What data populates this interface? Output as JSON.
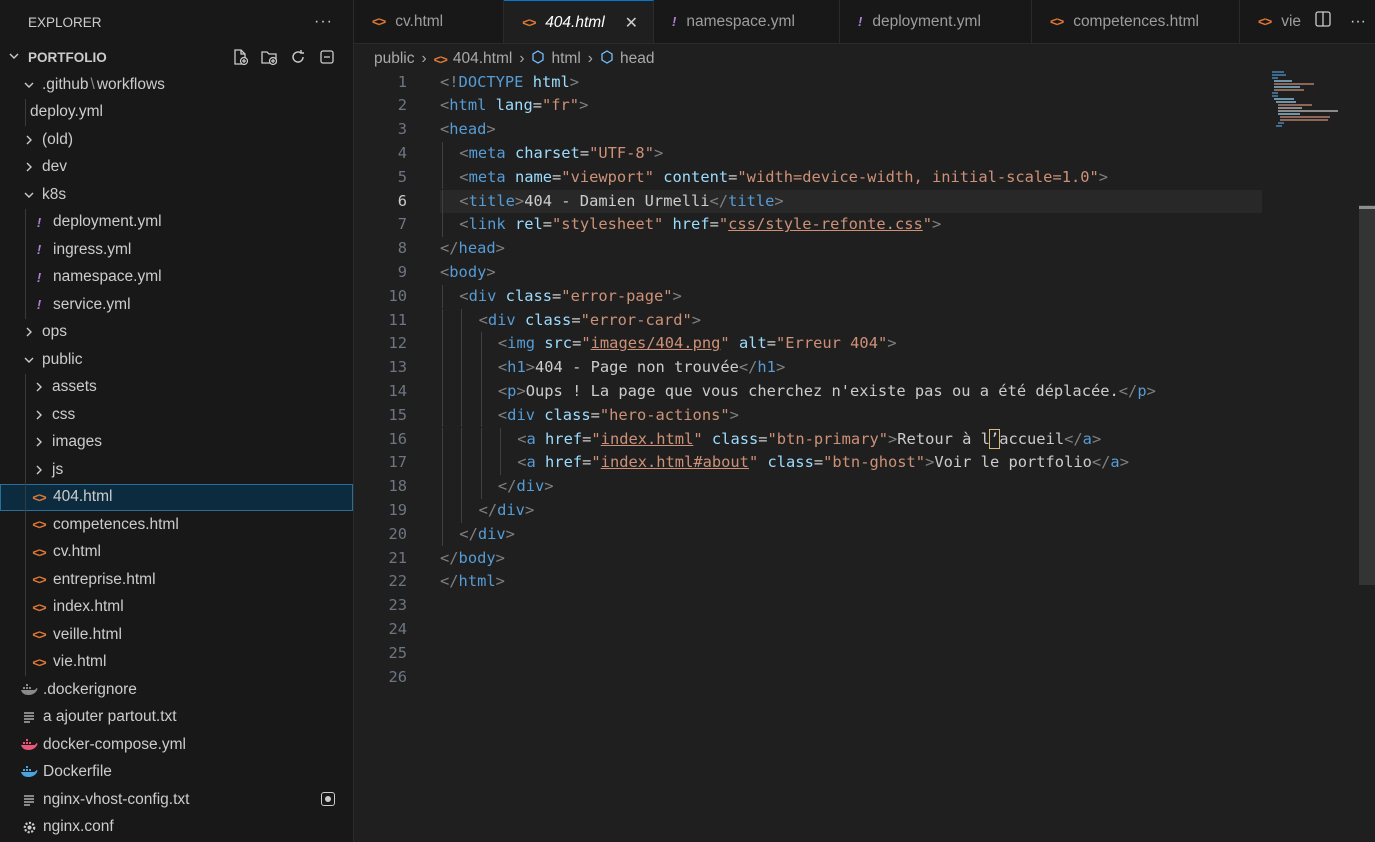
{
  "sidebar": {
    "title": "EXPLORER",
    "more": "···",
    "project": "PORTFOLIO",
    "items": [
      {
        "label": ".github",
        "label2": "workflows",
        "depth": 1,
        "kind": "folder-open"
      },
      {
        "label": "deploy.yml",
        "depth": 2,
        "kind": "file"
      },
      {
        "label": "(old)",
        "depth": 1,
        "kind": "folder"
      },
      {
        "label": "dev",
        "depth": 1,
        "kind": "folder"
      },
      {
        "label": "k8s",
        "depth": 1,
        "kind": "folder-open"
      },
      {
        "label": "deployment.yml",
        "depth": 2,
        "kind": "yml"
      },
      {
        "label": "ingress.yml",
        "depth": 2,
        "kind": "yml"
      },
      {
        "label": "namespace.yml",
        "depth": 2,
        "kind": "yml"
      },
      {
        "label": "service.yml",
        "depth": 2,
        "kind": "yml"
      },
      {
        "label": "ops",
        "depth": 1,
        "kind": "folder"
      },
      {
        "label": "public",
        "depth": 1,
        "kind": "folder-open"
      },
      {
        "label": "assets",
        "depth": 2,
        "kind": "folder"
      },
      {
        "label": "css",
        "depth": 2,
        "kind": "folder"
      },
      {
        "label": "images",
        "depth": 2,
        "kind": "folder"
      },
      {
        "label": "js",
        "depth": 2,
        "kind": "folder"
      },
      {
        "label": "404.html",
        "depth": 2,
        "kind": "html",
        "selected": true
      },
      {
        "label": "competences.html",
        "depth": 2,
        "kind": "html"
      },
      {
        "label": "cv.html",
        "depth": 2,
        "kind": "html"
      },
      {
        "label": "entreprise.html",
        "depth": 2,
        "kind": "html"
      },
      {
        "label": "index.html",
        "depth": 2,
        "kind": "html"
      },
      {
        "label": "veille.html",
        "depth": 2,
        "kind": "html"
      },
      {
        "label": "vie.html",
        "depth": 2,
        "kind": "html"
      },
      {
        "label": ".dockerignore",
        "depth": 1,
        "kind": "docker-grey"
      },
      {
        "label": "a ajouter partout.txt",
        "depth": 1,
        "kind": "txt"
      },
      {
        "label": "docker-compose.yml",
        "depth": 1,
        "kind": "docker-pink"
      },
      {
        "label": "Dockerfile",
        "depth": 1,
        "kind": "docker-blue"
      },
      {
        "label": "nginx-vhost-config.txt",
        "depth": 1,
        "kind": "txt",
        "badge": true
      },
      {
        "label": "nginx.conf",
        "depth": 1,
        "kind": "gear"
      }
    ]
  },
  "tabs": [
    {
      "label": "cv.html",
      "kind": "html"
    },
    {
      "label": "404.html",
      "kind": "html",
      "active": true,
      "close": "✕"
    },
    {
      "label": "namespace.yml",
      "kind": "yml"
    },
    {
      "label": "deployment.yml",
      "kind": "yml"
    },
    {
      "label": "competences.html",
      "kind": "html"
    },
    {
      "label": "vie",
      "kind": "html"
    }
  ],
  "breadcrumb": {
    "folder": "public",
    "file": "404.html",
    "el1": "html",
    "el2": "head"
  },
  "editor": {
    "current_line": 6,
    "lines": [
      {
        "n": "1",
        "i": 0,
        "tokens": [
          [
            "p",
            "<!"
          ],
          [
            "t",
            "DOCTYPE"
          ],
          [
            "x",
            " "
          ],
          [
            "a",
            "html"
          ],
          [
            "p",
            ">"
          ]
        ]
      },
      {
        "n": "2",
        "i": 0,
        "tokens": [
          [
            "p",
            "<"
          ],
          [
            "t",
            "html"
          ],
          [
            "x",
            " "
          ],
          [
            "a",
            "lang"
          ],
          [
            "x",
            "="
          ],
          [
            "s",
            "\"fr\""
          ],
          [
            "p",
            ">"
          ]
        ]
      },
      {
        "n": "3",
        "i": 0,
        "tokens": [
          [
            "p",
            "<"
          ],
          [
            "t",
            "head"
          ],
          [
            "p",
            ">"
          ]
        ]
      },
      {
        "n": "4",
        "i": 1,
        "tokens": [
          [
            "p",
            "<"
          ],
          [
            "t",
            "meta"
          ],
          [
            "x",
            " "
          ],
          [
            "a",
            "charset"
          ],
          [
            "x",
            "="
          ],
          [
            "s",
            "\"UTF-8\""
          ],
          [
            "p",
            ">"
          ]
        ]
      },
      {
        "n": "5",
        "i": 1,
        "tokens": [
          [
            "p",
            "<"
          ],
          [
            "t",
            "meta"
          ],
          [
            "x",
            " "
          ],
          [
            "a",
            "name"
          ],
          [
            "x",
            "="
          ],
          [
            "s",
            "\"viewport\""
          ],
          [
            "x",
            " "
          ],
          [
            "a",
            "content"
          ],
          [
            "x",
            "="
          ],
          [
            "s",
            "\"width=device-width, initial-scale=1.0\""
          ],
          [
            "p",
            ">"
          ]
        ]
      },
      {
        "n": "6",
        "i": 1,
        "tokens": [
          [
            "p",
            "<"
          ],
          [
            "t",
            "title"
          ],
          [
            "p",
            ">"
          ],
          [
            "x",
            "404 - Damien Urmelli"
          ],
          [
            "p",
            "</"
          ],
          [
            "t",
            "title"
          ],
          [
            "p",
            ">"
          ]
        ]
      },
      {
        "n": "7",
        "i": 1,
        "tokens": [
          [
            "p",
            "<"
          ],
          [
            "t",
            "link"
          ],
          [
            "x",
            " "
          ],
          [
            "a",
            "rel"
          ],
          [
            "x",
            "="
          ],
          [
            "s",
            "\"stylesheet\""
          ],
          [
            "x",
            " "
          ],
          [
            "a",
            "href"
          ],
          [
            "x",
            "="
          ],
          [
            "s",
            "\""
          ],
          [
            "su",
            "css/style-refonte.css"
          ],
          [
            "s",
            "\""
          ],
          [
            "p",
            ">"
          ]
        ]
      },
      {
        "n": "8",
        "i": 0,
        "tokens": [
          [
            "p",
            "</"
          ],
          [
            "t",
            "head"
          ],
          [
            "p",
            ">"
          ]
        ]
      },
      {
        "n": "9",
        "i": 0,
        "tokens": [
          [
            "p",
            "<"
          ],
          [
            "t",
            "body"
          ],
          [
            "p",
            ">"
          ]
        ]
      },
      {
        "n": "10",
        "i": 1,
        "tokens": [
          [
            "p",
            "<"
          ],
          [
            "t",
            "div"
          ],
          [
            "x",
            " "
          ],
          [
            "a",
            "class"
          ],
          [
            "x",
            "="
          ],
          [
            "s",
            "\"error-page\""
          ],
          [
            "p",
            ">"
          ]
        ]
      },
      {
        "n": "11",
        "i": 2,
        "tokens": [
          [
            "p",
            "<"
          ],
          [
            "t",
            "div"
          ],
          [
            "x",
            " "
          ],
          [
            "a",
            "class"
          ],
          [
            "x",
            "="
          ],
          [
            "s",
            "\"error-card\""
          ],
          [
            "p",
            ">"
          ]
        ]
      },
      {
        "n": "12",
        "i": 3,
        "tokens": [
          [
            "p",
            "<"
          ],
          [
            "t",
            "img"
          ],
          [
            "x",
            " "
          ],
          [
            "a",
            "src"
          ],
          [
            "x",
            "="
          ],
          [
            "s",
            "\""
          ],
          [
            "su",
            "images/404.png"
          ],
          [
            "s",
            "\""
          ],
          [
            "x",
            " "
          ],
          [
            "a",
            "alt"
          ],
          [
            "x",
            "="
          ],
          [
            "s",
            "\"Erreur 404\""
          ],
          [
            "p",
            ">"
          ]
        ]
      },
      {
        "n": "13",
        "i": 3,
        "tokens": [
          [
            "p",
            "<"
          ],
          [
            "t",
            "h1"
          ],
          [
            "p",
            ">"
          ],
          [
            "x",
            "404 - Page non trouvée"
          ],
          [
            "p",
            "</"
          ],
          [
            "t",
            "h1"
          ],
          [
            "p",
            ">"
          ]
        ]
      },
      {
        "n": "14",
        "i": 3,
        "tokens": [
          [
            "p",
            "<"
          ],
          [
            "t",
            "p"
          ],
          [
            "p",
            ">"
          ],
          [
            "x",
            "Oups ! La page que vous cherchez n'existe pas ou a été déplacée."
          ],
          [
            "p",
            "</"
          ],
          [
            "t",
            "p"
          ],
          [
            "p",
            ">"
          ]
        ]
      },
      {
        "n": "15",
        "i": 3,
        "tokens": [
          [
            "p",
            "<"
          ],
          [
            "t",
            "div"
          ],
          [
            "x",
            " "
          ],
          [
            "a",
            "class"
          ],
          [
            "x",
            "="
          ],
          [
            "s",
            "\"hero-actions\""
          ],
          [
            "p",
            ">"
          ]
        ]
      },
      {
        "n": "16",
        "i": 4,
        "tokens": [
          [
            "p",
            "<"
          ],
          [
            "t",
            "a"
          ],
          [
            "x",
            " "
          ],
          [
            "a",
            "href"
          ],
          [
            "x",
            "="
          ],
          [
            "s",
            "\""
          ],
          [
            "su",
            "index.html"
          ],
          [
            "s",
            "\""
          ],
          [
            "x",
            " "
          ],
          [
            "a",
            "class"
          ],
          [
            "x",
            "="
          ],
          [
            "s",
            "\"btn-primary\""
          ],
          [
            "p",
            ">"
          ],
          [
            "x",
            "Retour à l"
          ],
          [
            "xc",
            "’"
          ],
          [
            "x",
            "accueil"
          ],
          [
            "p",
            "</"
          ],
          [
            "t",
            "a"
          ],
          [
            "p",
            ">"
          ]
        ]
      },
      {
        "n": "17",
        "i": 4,
        "tokens": [
          [
            "p",
            "<"
          ],
          [
            "t",
            "a"
          ],
          [
            "x",
            " "
          ],
          [
            "a",
            "href"
          ],
          [
            "x",
            "="
          ],
          [
            "s",
            "\""
          ],
          [
            "su",
            "index.html#about"
          ],
          [
            "s",
            "\""
          ],
          [
            "x",
            " "
          ],
          [
            "a",
            "class"
          ],
          [
            "x",
            "="
          ],
          [
            "s",
            "\"btn-ghost\""
          ],
          [
            "p",
            ">"
          ],
          [
            "x",
            "Voir le portfolio"
          ],
          [
            "p",
            "</"
          ],
          [
            "t",
            "a"
          ],
          [
            "p",
            ">"
          ]
        ]
      },
      {
        "n": "18",
        "i": 3,
        "tokens": [
          [
            "p",
            "</"
          ],
          [
            "t",
            "div"
          ],
          [
            "p",
            ">"
          ]
        ]
      },
      {
        "n": "19",
        "i": 2,
        "tokens": [
          [
            "p",
            "</"
          ],
          [
            "t",
            "div"
          ],
          [
            "p",
            ">"
          ]
        ]
      },
      {
        "n": "20",
        "i": 1,
        "tokens": [
          [
            "p",
            "</"
          ],
          [
            "t",
            "div"
          ],
          [
            "p",
            ">"
          ]
        ]
      },
      {
        "n": "21",
        "i": 0,
        "tokens": [
          [
            "p",
            "</"
          ],
          [
            "t",
            "body"
          ],
          [
            "p",
            ">"
          ]
        ]
      },
      {
        "n": "22",
        "i": 0,
        "tokens": [
          [
            "p",
            "</"
          ],
          [
            "t",
            "html"
          ],
          [
            "p",
            ">"
          ]
        ]
      },
      {
        "n": "23",
        "i": 0,
        "tokens": []
      },
      {
        "n": "24",
        "i": 0,
        "tokens": []
      },
      {
        "n": "25",
        "i": 0,
        "tokens": []
      },
      {
        "n": "26",
        "i": 0,
        "tokens": []
      }
    ]
  },
  "colors": {
    "tag": "#569cd6",
    "attr": "#9cdcfe",
    "string": "#ce9178",
    "punct": "#808080",
    "yml_icon": "#b180d7",
    "html_icon": "#e37933",
    "accent": "#0078d4"
  }
}
